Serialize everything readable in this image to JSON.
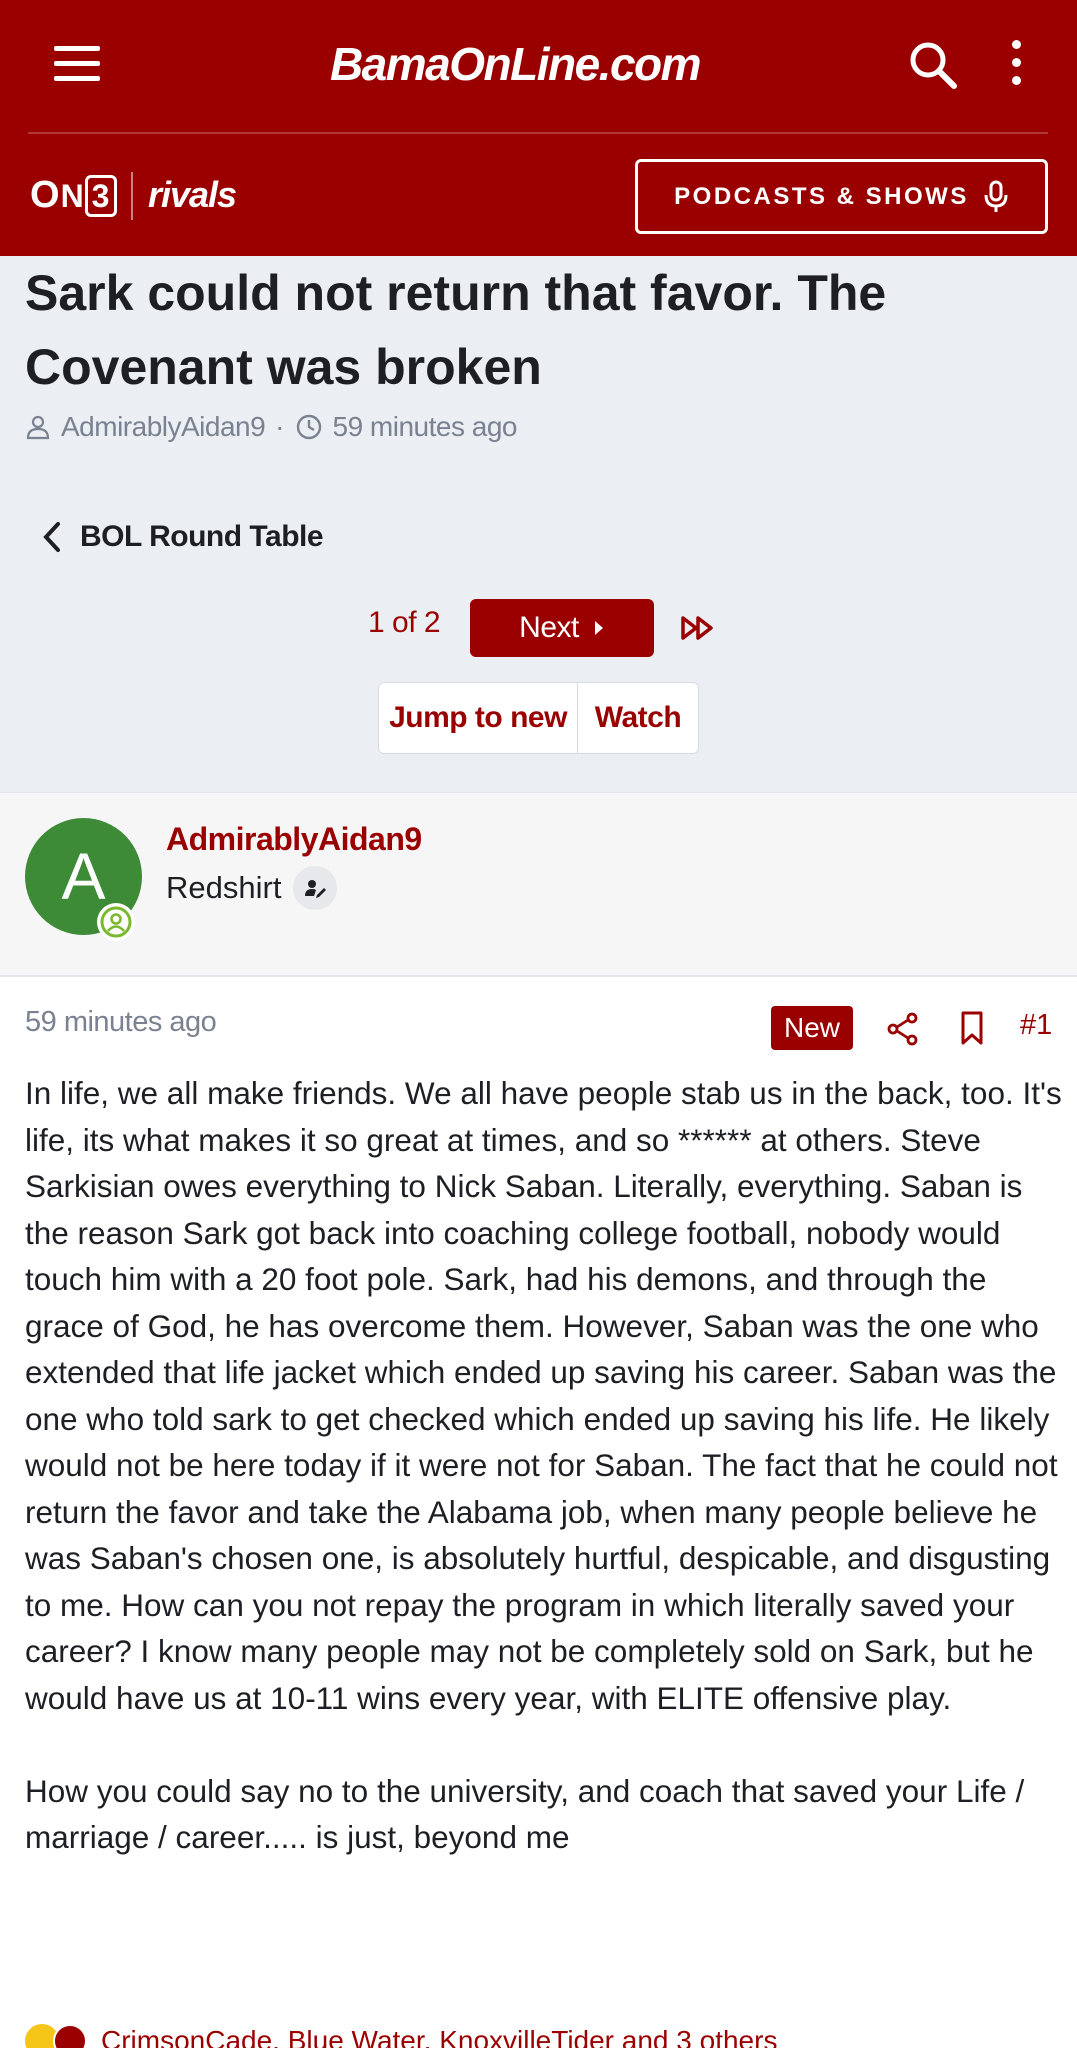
{
  "header": {
    "brand": "BamaOnLine.com",
    "partner_on3": "ON3",
    "partner_rivals": "rivals",
    "podcasts_label": "PODCASTS & SHOWS"
  },
  "thread": {
    "title": "Sark could not return that favor. The Covenant was broken",
    "author": "AdmirablyAidan9",
    "separator": "·",
    "time": "59 minutes ago",
    "back_label": "BOL Round Table",
    "page_indicator": "1 of 2",
    "next_label": "Next",
    "jump_label": "Jump to new",
    "watch_label": "Watch"
  },
  "user": {
    "avatar_letter": "A",
    "name": "AdmirablyAidan9",
    "rank": "Redshirt"
  },
  "post": {
    "time": "59 minutes ago",
    "badge": "New",
    "number": "#1",
    "paragraphs": [
      "In life, we all make friends. We all have people stab us in the back, too. It's life, its what makes it so great at times, and so ****** at others. Steve Sarkisian owes everything to Nick Saban. Literally, everything. Saban is the reason Sark got back into coaching college football, nobody would touch him with a 20 foot pole. Sark, had his demons, and through the grace of God, he has overcome them. However, Saban was the one who extended that life jacket which ended up saving his career. Saban was the one who told sark to get checked which ended up saving his life. He likely would not be here today if it were not for Saban. The fact that he could not return the favor and take the Alabama job, when many people believe he was Saban's chosen one, is absolutely hurtful, despicable, and disgusting to me. How can you not repay the program in which literally saved your career? I know many people may not be completely sold on Sark, but he would have us at 10-11 wins every year, with ELITE offensive play.",
      "How you could say no to the university, and coach that saved your Life / marriage / career..... is just, beyond me"
    ],
    "reactions_text": "CrimsonCade, Blue Water, KnoxvilleTider and 3 others"
  },
  "colors": {
    "brand_red": "#9b0000",
    "title_bg": "#ebeef3",
    "muted_text": "#7a8190",
    "avatar_green": "#3d8b36"
  }
}
